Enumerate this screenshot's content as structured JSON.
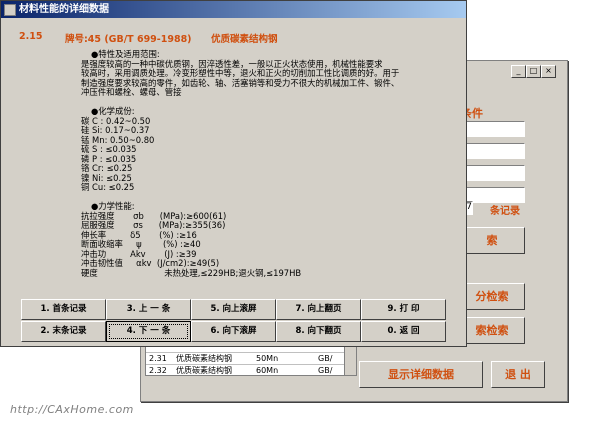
{
  "watermark": "http://CAxHome.com",
  "dialog": {
    "title": "材料性能的详细数据",
    "header": {
      "no": "2.15",
      "grade": "牌号:45 (GB/T 699-1988)",
      "type": "优质碳素结构钢"
    },
    "lines": [
      "●特性及适用范围:",
      "是强度较高的一种中碳优质钢，因淬透性差，一般以正火状态使用，机械性能要求",
      "较高时，采用调质处理。冷变形塑性中等，退火和正火的切削加工性比调质的好。用于",
      "制造强度要求较高的零件，如齿轮、轴、活塞销等和受力不很大的机械加工件、锻件、",
      "冲压件和螺栓、螺母、管接",
      "",
      "●化学成份:",
      "碳 C : 0.42~0.50",
      "硅 Si: 0.17~0.37",
      "锰 Mn: 0.50~0.80",
      "硫 S : ≤0.035",
      "磷 P : ≤0.035",
      "铬 Cr: ≤0.25",
      "镍 Ni: ≤0.25",
      "铜 Cu: ≤0.25",
      "",
      "●力学性能:",
      "抗拉强度       σb      (MPa):≥600(61)",
      "屈服强度       σs      (MPa):≥355(36)",
      "伸长率         δ5       (%) :≥16",
      "断面收缩率     ψ        (%) :≥40",
      "冲击功         Akv       (J) :≥39",
      "冲击韧性值     αkv  (J/cm2):≥49(5)",
      "硬度                         未热处理,≤229HB;退火钢,≤197HB"
    ],
    "buttons": [
      "1. 首条记录",
      "3. 上 一 条",
      "5. 向上滚屏",
      "7. 向上翻页",
      "9. 打  印",
      "2. 末条记录",
      "4. 下 一 条",
      "6. 向下滚屏",
      "8. 向下翻页",
      "0. 返  回"
    ]
  },
  "background": {
    "panel_label": "条件",
    "count_value": "7",
    "count_label": "条记录",
    "button1": "索",
    "button2": "分检索",
    "button3": "索检索",
    "show_detail": "显示详细数据",
    "exit": "退 出",
    "table_rows": [
      {
        "no": "",
        "name": "",
        "spec": "",
        "std": ""
      },
      {
        "no": "2.31",
        "name": "优质碳素结构钢",
        "spec": "50Mn",
        "std": "GB/"
      },
      {
        "no": "2.32",
        "name": "优质碳素结构钢",
        "spec": "60Mn",
        "std": "GB/"
      }
    ]
  },
  "colors": {
    "accent": "#d05010",
    "title_start": "#0a246a",
    "title_end": "#a6caf0",
    "face": "#d4d0c8"
  }
}
